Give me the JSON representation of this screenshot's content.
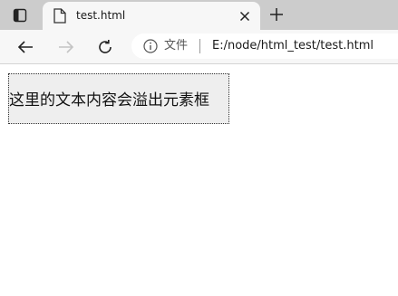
{
  "browser": {
    "tab": {
      "title": "test.html",
      "icons": [
        "tab-actions-icon",
        "file-icon",
        "close-icon",
        "new-tab-icon"
      ]
    },
    "toolbar": {
      "icons": [
        "back-icon",
        "forward-icon",
        "refresh-icon",
        "info-icon"
      ],
      "address": {
        "scheme_label": "文件",
        "url": "E:/node/html_test/test.html"
      }
    }
  },
  "page": {
    "box_text": "这里的文本内容会溢出元素框",
    "box_colors": {
      "background": "#eeeeee",
      "border": "#333333"
    }
  }
}
